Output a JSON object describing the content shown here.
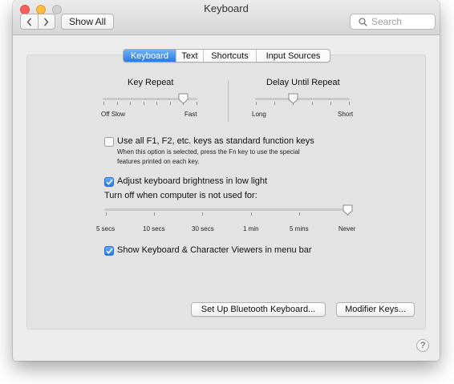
{
  "window": {
    "title": "Keyboard"
  },
  "toolbar": {
    "back_icon": "chevron-left-icon",
    "forward_icon": "chevron-right-icon",
    "show_all_label": "Show All",
    "search_placeholder": "Search",
    "search_value": ""
  },
  "tabs": [
    {
      "label": "Keyboard",
      "active": true
    },
    {
      "label": "Text",
      "active": false
    },
    {
      "label": "Shortcuts",
      "active": false
    },
    {
      "label": "Input Sources",
      "active": false
    }
  ],
  "key_repeat": {
    "label": "Key Repeat",
    "min_label": "Off Slow",
    "max_label": "Fast",
    "tick_count": 8,
    "level": 6
  },
  "delay_until_repeat": {
    "label": "Delay Until Repeat",
    "min_label": "Long",
    "max_label": "Short",
    "tick_count": 6,
    "level": 2
  },
  "function_keys": {
    "label": "Use all F1, F2, etc. keys as standard function keys",
    "checked": false,
    "description_line1": "When this option is selected, press the Fn key to use the special",
    "description_line2": "features printed on each key."
  },
  "brightness": {
    "label": "Adjust keyboard brightness in low light",
    "checked": true
  },
  "turn_off": {
    "label": "Turn off when computer is not used for:",
    "options": [
      "5 secs",
      "10 secs",
      "30 secs",
      "1 min",
      "5 mins",
      "Never"
    ],
    "selected": "Never"
  },
  "viewers": {
    "label": "Show Keyboard & Character Viewers in menu bar",
    "checked": true
  },
  "buttons": {
    "bluetooth": "Set Up Bluetooth Keyboard...",
    "modifier": "Modifier Keys..."
  },
  "help_label": "?",
  "colors": {
    "accent": "#2b7de0",
    "close": "#fc605c",
    "minimize": "#fdbc40",
    "zoom": "#d0d0d0"
  }
}
